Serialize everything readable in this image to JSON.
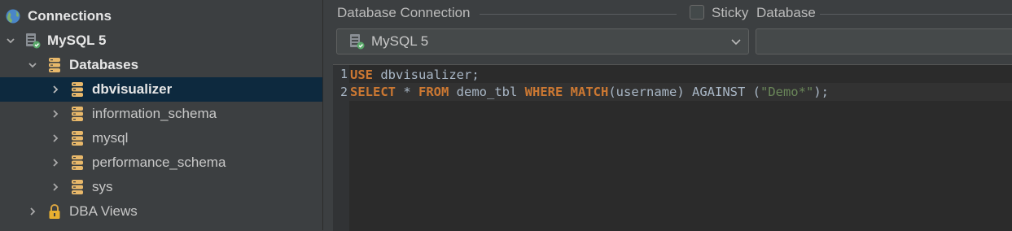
{
  "tree": {
    "items": [
      {
        "label": "Connections",
        "icon": "globe-icon",
        "expanded": true
      },
      {
        "label": "MySQL 5",
        "icon": "database-connection-icon",
        "expanded": true
      },
      {
        "label": "Databases",
        "icon": "databases-icon",
        "expanded": true
      },
      {
        "label": "dbvisualizer",
        "icon": "database-icon",
        "selected": true
      },
      {
        "label": "information_schema",
        "icon": "database-icon"
      },
      {
        "label": "mysql",
        "icon": "database-icon"
      },
      {
        "label": "performance_schema",
        "icon": "database-icon"
      },
      {
        "label": "sys",
        "icon": "database-icon"
      },
      {
        "label": "DBA Views",
        "icon": "lock-icon"
      }
    ]
  },
  "editor": {
    "connection_label": "Database Connection",
    "sticky_label": "Sticky",
    "database_label": "Database",
    "connection_value": "MySQL 5",
    "database_value": "",
    "line_numbers": [
      "1",
      "2"
    ],
    "code": {
      "l1_kw": "USE",
      "l1_rest": " dbvisualizer;",
      "l2_kw1": "SELECT",
      "l2_t1": " * ",
      "l2_kw2": "FROM",
      "l2_t2": " demo_tbl ",
      "l2_kw3": "WHERE",
      "l2_t3": " ",
      "l2_kw4": "MATCH",
      "l2_t4": "(username) AGAINST (",
      "l2_str": "\"Demo*\"",
      "l2_t5": ");"
    }
  },
  "colors": {
    "keyword": "#cc7832",
    "string": "#6a8759",
    "selection": "#0d293e",
    "db_icon": "#e8b86a"
  }
}
